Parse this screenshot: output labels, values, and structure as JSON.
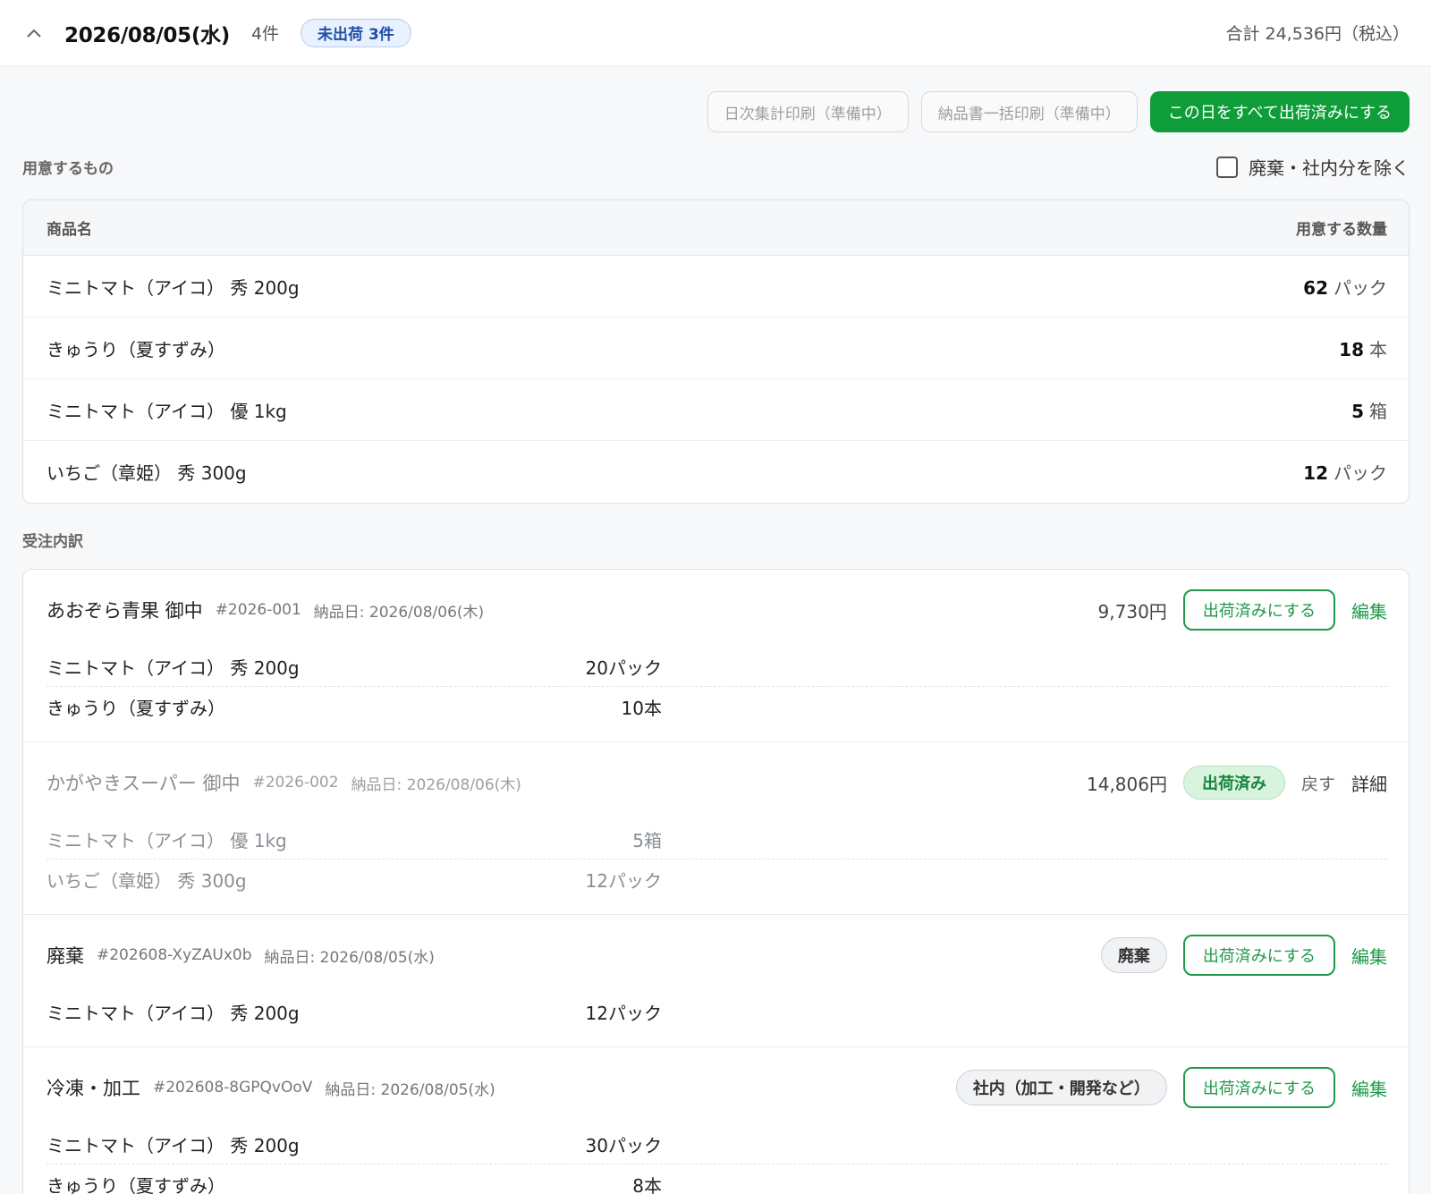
{
  "header": {
    "date": "2026/08/05(水)",
    "count": "4件",
    "pending_badge": "未出荷 3件",
    "total": "合計 24,536円（税込）"
  },
  "toolbar": {
    "daily_print": "日次集計印刷（準備中）",
    "invoice_print": "納品書一括印刷（準備中）",
    "ship_all": "この日をすべて出荷済みにする"
  },
  "prep": {
    "title": "用意するもの",
    "exclude_label": "廃棄・社内分を除く",
    "col_name": "商品名",
    "col_qty": "用意する数量",
    "rows": [
      {
        "name": "ミニトマト（アイコ） 秀 200g",
        "qty": "62",
        "unit": "パック"
      },
      {
        "name": "きゅうり（夏すずみ）",
        "qty": "18",
        "unit": "本"
      },
      {
        "name": "ミニトマト（アイコ） 優 1kg",
        "qty": "5",
        "unit": "箱"
      },
      {
        "name": "いちご（章姫） 秀 300g",
        "qty": "12",
        "unit": "パック"
      }
    ]
  },
  "orders_title": "受注内訳",
  "orders": [
    {
      "customer": "あおぞら青果 御中",
      "id": "#2026-001",
      "delivery": "納品日: 2026/08/06(木)",
      "amount": "9,730円",
      "action": "出荷済みにする",
      "link": "編集",
      "lines": [
        {
          "name": "ミニトマト（アイコ） 秀 200g",
          "qty": "20パック"
        },
        {
          "name": "きゅうり（夏すずみ）",
          "qty": "10本"
        }
      ]
    },
    {
      "customer": "かがやきスーパー 御中",
      "id": "#2026-002",
      "delivery": "納品日: 2026/08/06(木)",
      "amount": "14,806円",
      "status": "出荷済み",
      "undo": "戻す",
      "link": "詳細",
      "lines": [
        {
          "name": "ミニトマト（アイコ） 優 1kg",
          "qty": "5箱"
        },
        {
          "name": "いちご（章姫） 秀 300g",
          "qty": "12パック"
        }
      ]
    },
    {
      "customer": "廃棄",
      "id": "#202608-XyZAUx0b",
      "delivery": "納品日: 2026/08/05(水)",
      "tag": "廃棄",
      "action": "出荷済みにする",
      "link": "編集",
      "lines": [
        {
          "name": "ミニトマト（アイコ） 秀 200g",
          "qty": "12パック"
        }
      ]
    },
    {
      "customer": "冷凍・加工",
      "id": "#202608-8GPQvOoV",
      "delivery": "納品日: 2026/08/05(水)",
      "tag": "社内（加工・開発など）",
      "action": "出荷済みにする",
      "link": "編集",
      "lines": [
        {
          "name": "ミニトマト（アイコ） 秀 200g",
          "qty": "30パック"
        },
        {
          "name": "きゅうり（夏すずみ）",
          "qty": "8本"
        }
      ]
    }
  ]
}
